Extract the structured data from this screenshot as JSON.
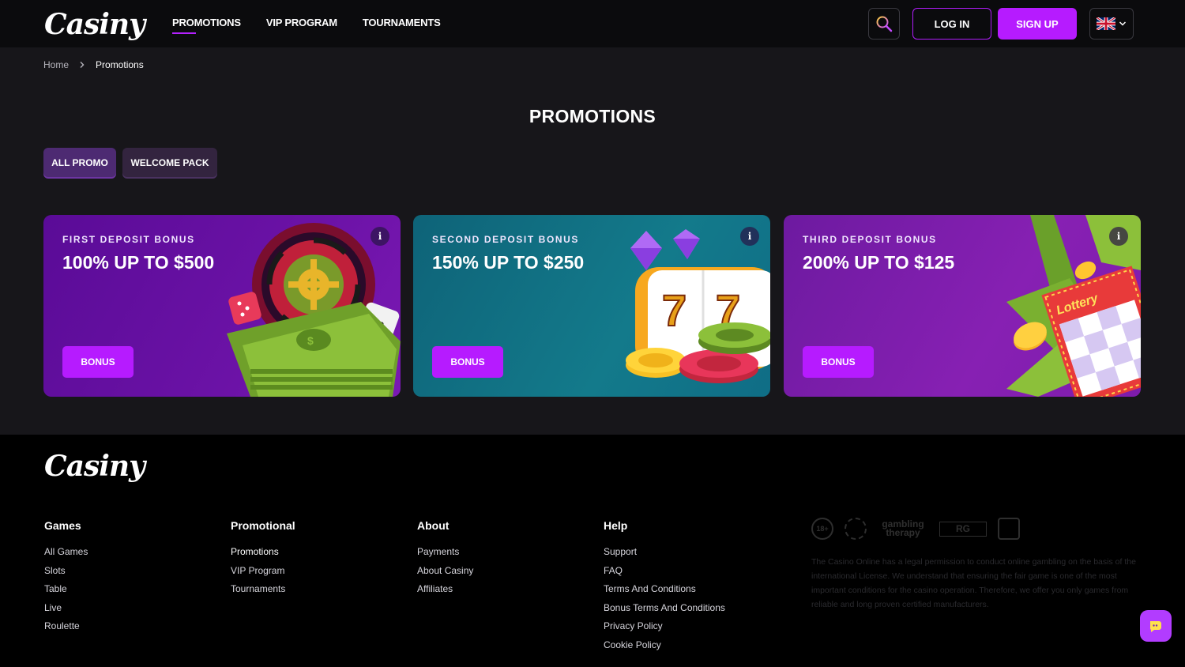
{
  "header": {
    "logo": "Casiny",
    "nav": [
      {
        "label": "PROMOTIONS",
        "active": true
      },
      {
        "label": "VIP PROGRAM",
        "active": false
      },
      {
        "label": "TOURNAMENTS",
        "active": false
      }
    ],
    "login_label": "LOG IN",
    "signup_label": "SIGN UP",
    "icons": {
      "search": "search-icon",
      "language": "uk-flag-icon"
    }
  },
  "breadcrumb": {
    "home": "Home",
    "current": "Promotions"
  },
  "page_title": "PROMOTIONS",
  "filters": [
    {
      "label": "ALL PROMO",
      "active": true
    },
    {
      "label": "WELCOME PACK",
      "active": false
    }
  ],
  "promos": [
    {
      "label": "FIRST DEPOSIT BONUS",
      "title": "100% UP TO $500",
      "button": "BONUS",
      "art": "roulette-icon"
    },
    {
      "label": "SECOND DEPOSIT BONUS",
      "title": "150% UP TO $250",
      "button": "BONUS",
      "art": "slot-machine-icon"
    },
    {
      "label": "THIRD DEPOSIT BONUS",
      "title": "200% UP TO $125",
      "button": "BONUS",
      "art": "lottery-ticket-icon",
      "art_text": "Lottery"
    }
  ],
  "footer": {
    "logo": "Casiny",
    "columns": [
      {
        "title": "Games",
        "links": [
          "All Games",
          "Slots",
          "Table",
          "Live",
          "Roulette"
        ]
      },
      {
        "title": "Promotional",
        "links": [
          "Promotions",
          "VIP Program",
          "Tournaments"
        ]
      },
      {
        "title": "About",
        "links": [
          "Payments",
          "About Casiny",
          "Affiliates"
        ]
      },
      {
        "title": "Help",
        "links": [
          "Support",
          "FAQ",
          "Terms And Conditions",
          "Bonus Terms And Conditions",
          "Privacy Policy",
          "Cookie Policy"
        ]
      }
    ],
    "badges": {
      "age": "18+",
      "gambling_therapy": "gambling therapy",
      "responsible": "RG"
    },
    "license_text": "The Casino Online has a legal permission to conduct online gambling on the basis of the international License. We understand that ensuring the fair game is one of the most important conditions for the casino operation. Therefore, we offer you only games from reliable and long proven certified manufacturers."
  },
  "colors": {
    "accent": "#b61bff",
    "header_bg": "#0b0b0d",
    "page_bg": "#17161a",
    "footer_bg": "#000000"
  }
}
